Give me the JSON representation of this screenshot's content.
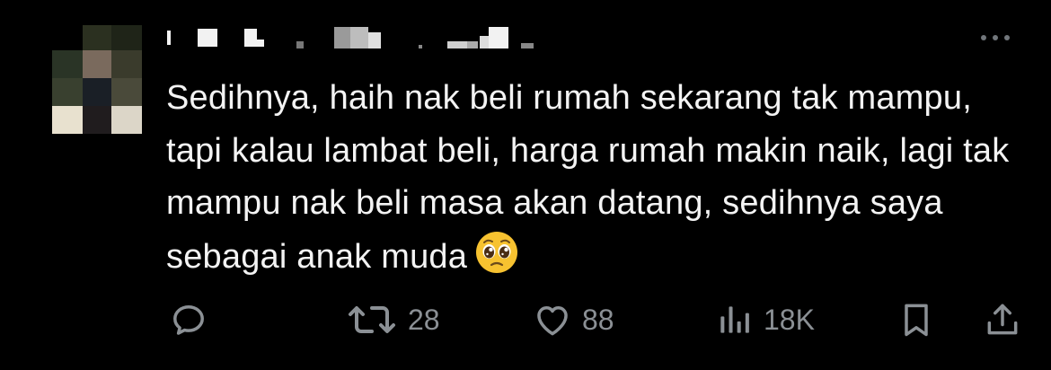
{
  "post": {
    "text": "Sedihnya, haih nak beli rumah sekarang tak mampu, tapi kalau lambat beli, harga rumah makin naik, lagi tak mampu nak beli masa akan datang, sedihnya saya sebagai anak muda",
    "emoji": "pleading-face",
    "avatar": "pixelated",
    "username": "censored"
  },
  "actions": {
    "reply_icon": "reply-icon",
    "repost_count": "28",
    "like_count": "88",
    "views_count": "18K",
    "bookmark_icon": "bookmark-icon",
    "share_icon": "share-icon"
  },
  "colors": {
    "background": "#000000",
    "text": "#e7e9ea",
    "secondary": "#71767b",
    "emoji": "#f7c230"
  }
}
